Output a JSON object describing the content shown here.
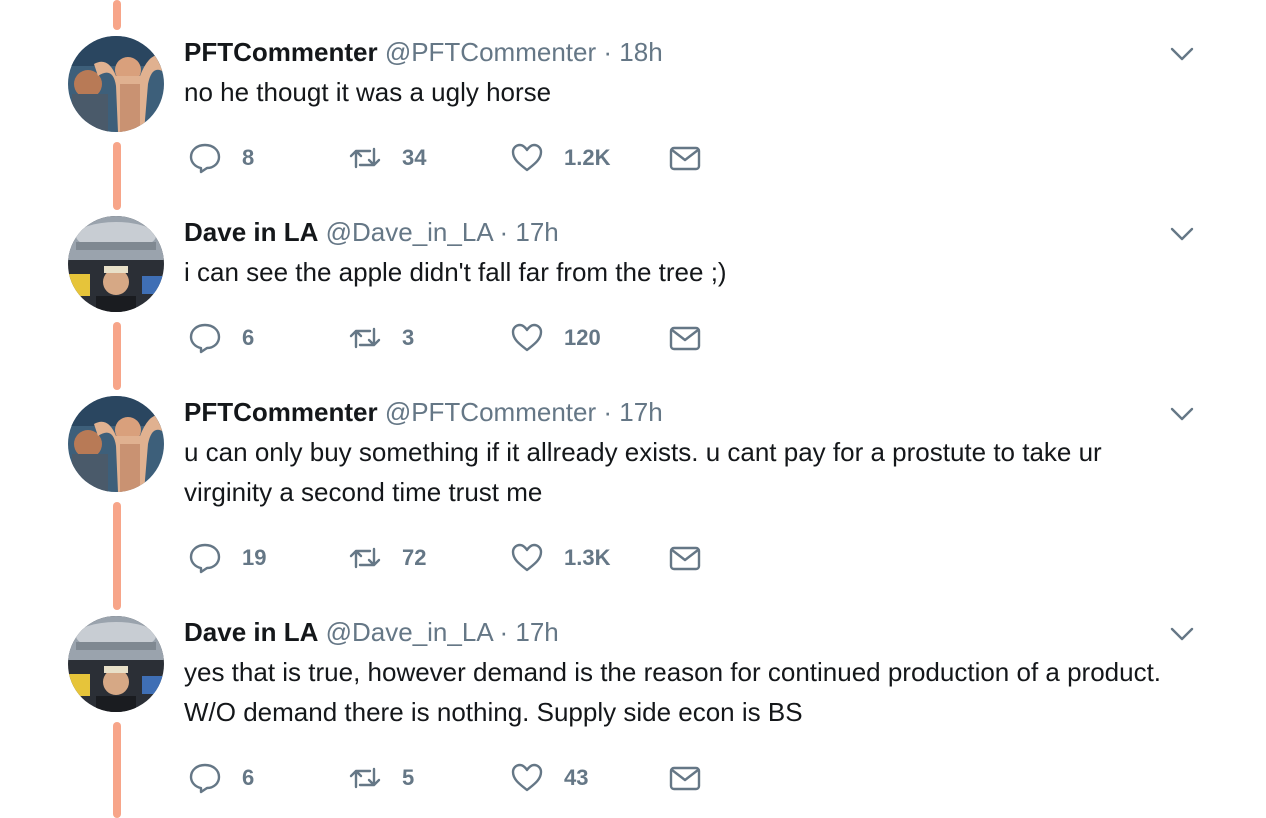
{
  "colors": {
    "thread_line": "#f7a589",
    "name": "#14171a",
    "meta": "#657786",
    "icon": "#657786"
  },
  "icons": {
    "reply": "reply-bubble-icon",
    "retweet": "retweet-arrows-icon",
    "like": "heart-icon",
    "dm": "envelope-icon",
    "caret": "chevron-down-icon"
  },
  "tweets": [
    {
      "name": "PFTCommenter",
      "handle": "@PFTCommenter",
      "separator": "·",
      "time": "18h",
      "text": "no he thougt it was a ugly horse",
      "replies": "8",
      "retweets": "34",
      "likes": "1.2K"
    },
    {
      "name": "Dave in LA",
      "handle": "@Dave_in_LA",
      "separator": "·",
      "time": "17h",
      "text": "i can see the apple didn't fall far from the tree ;)",
      "replies": "6",
      "retweets": "3",
      "likes": "120"
    },
    {
      "name": "PFTCommenter",
      "handle": "@PFTCommenter",
      "separator": "·",
      "time": "17h",
      "text": "u can only buy something if it allready exists. u cant pay for a prostute to take ur virginity a second time trust me",
      "replies": "19",
      "retweets": "72",
      "likes": "1.3K"
    },
    {
      "name": "Dave in LA",
      "handle": "@Dave_in_LA",
      "separator": "·",
      "time": "17h",
      "text": "yes that is true, however demand is the reason for continued production of a product. W/O demand there is nothing. Supply side econ is BS",
      "replies": "6",
      "retweets": "5",
      "likes": "43"
    }
  ]
}
